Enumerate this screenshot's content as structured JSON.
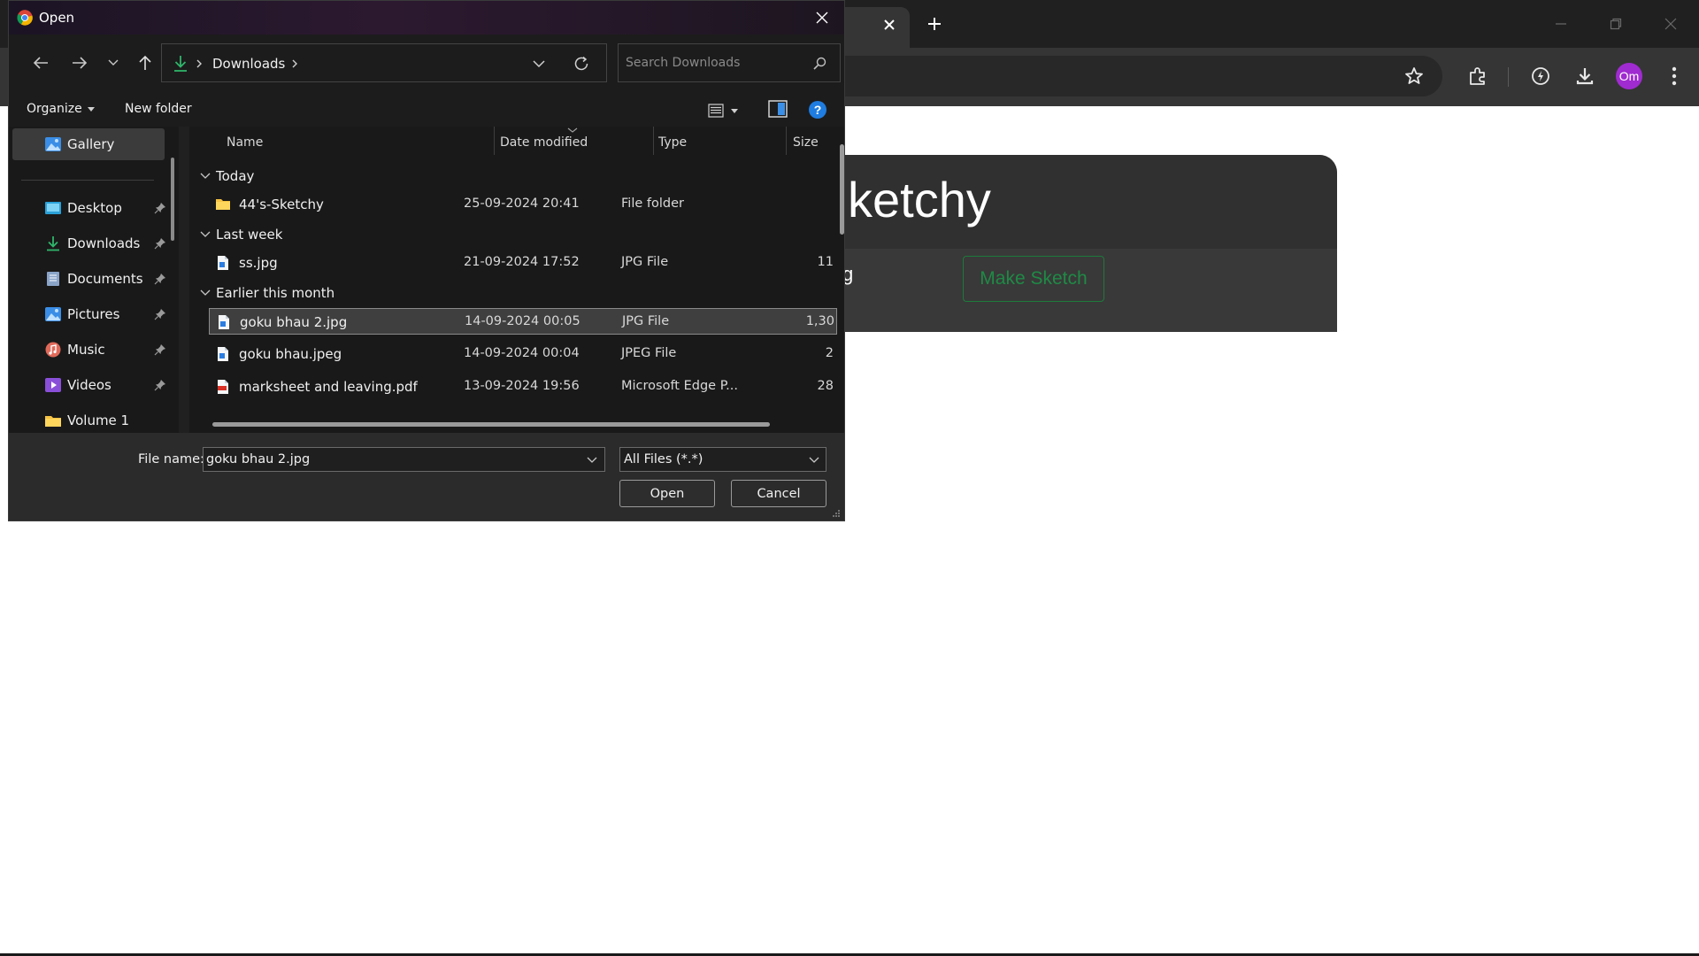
{
  "dialog": {
    "title": "Open",
    "address": {
      "location": "Downloads"
    },
    "search": {
      "placeholder": "Search Downloads"
    },
    "commands": {
      "organize": "Organize",
      "new_folder": "New folder"
    },
    "nav": [
      {
        "label": "Gallery",
        "icon": "gallery-icon",
        "selected": true
      },
      {
        "label": "Desktop",
        "icon": "desktop-icon",
        "pinned": true
      },
      {
        "label": "Downloads",
        "icon": "downloads-icon",
        "pinned": true
      },
      {
        "label": "Documents",
        "icon": "documents-icon",
        "pinned": true
      },
      {
        "label": "Pictures",
        "icon": "pictures-icon",
        "pinned": true
      },
      {
        "label": "Music",
        "icon": "music-icon",
        "pinned": true
      },
      {
        "label": "Videos",
        "icon": "videos-icon",
        "pinned": true
      },
      {
        "label": "Volume 1",
        "icon": "folder-icon"
      }
    ],
    "columns": {
      "name": "Name",
      "date": "Date modified",
      "type": "Type",
      "size": "Size"
    },
    "groups": [
      {
        "label": "Today"
      },
      {
        "label": "Last week"
      },
      {
        "label": "Earlier this month"
      }
    ],
    "files": [
      {
        "name": "44's-Sketchy",
        "date": "25-09-2024 20:41",
        "type": "File folder",
        "size": "",
        "icon": "folder-icon"
      },
      {
        "name": "ss.jpg",
        "date": "21-09-2024 17:52",
        "type": "JPG File",
        "size": "11",
        "icon": "image-file-icon"
      },
      {
        "name": "goku bhau 2.jpg",
        "date": "14-09-2024 00:05",
        "type": "JPG File",
        "size": "1,30",
        "icon": "image-file-icon",
        "selected": true
      },
      {
        "name": "goku bhau.jpeg",
        "date": "14-09-2024 00:04",
        "type": "JPEG File",
        "size": "2",
        "icon": "image-file-icon"
      },
      {
        "name": "marksheet and leaving.pdf",
        "date": "13-09-2024 19:56",
        "type": "Microsoft Edge P...",
        "size": "28",
        "icon": "pdf-file-icon"
      }
    ],
    "file_name_label": "File name:",
    "file_name_value": "goku bhau 2.jpg",
    "file_type_value": "All Files (*.*)",
    "open_label": "Open",
    "cancel_label": "Cancel"
  },
  "browser": {
    "avatar_initials": "Om",
    "page": {
      "title_fragment": "ketchy",
      "text_fragment": "g",
      "make_sketch_label": "Make Sketch"
    },
    "colors": {
      "accent_green": "#1f8a45",
      "avatar": "#a02bd0",
      "folder": "#f6c344",
      "download_arrow": "#2fb56b",
      "help_blue": "#1f7ce0"
    }
  }
}
